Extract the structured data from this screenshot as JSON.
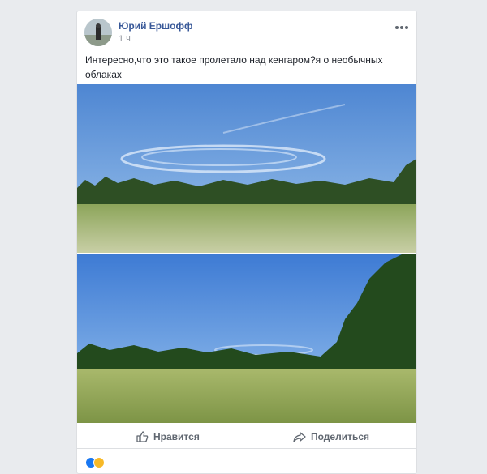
{
  "post": {
    "author": "Юрий Ершофф",
    "time": "1 ч",
    "text": "Интересно,что это такое пролетало над кенгаром?я о необычных облаках"
  },
  "actions": {
    "like_label": "Нравится",
    "share_label": "Поделиться"
  },
  "reactions": {
    "icons": [
      "like-reaction-icon",
      "haha-reaction-icon"
    ],
    "colors": {
      "like": "#1877f2",
      "haha": "#f7b928"
    }
  },
  "colors": {
    "page_bg": "#e9ebee",
    "author_link": "#385898",
    "action_text": "#606770"
  }
}
